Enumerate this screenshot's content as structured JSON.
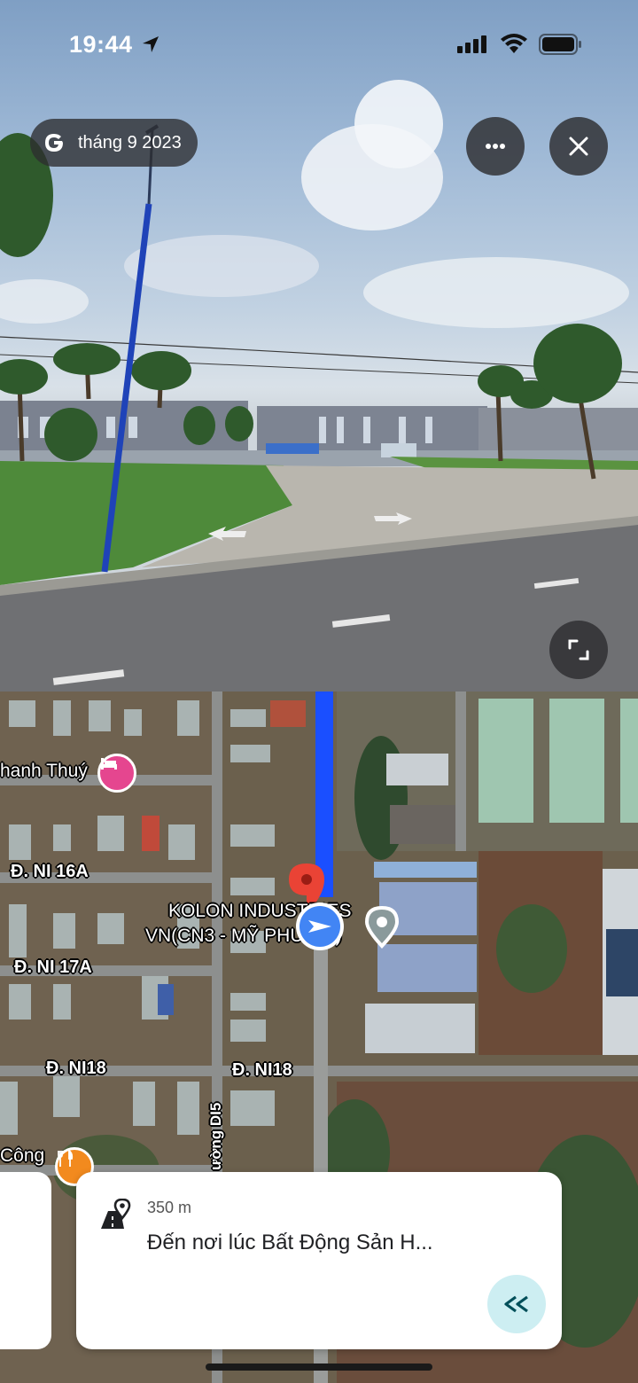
{
  "status_bar": {
    "time": "19:44"
  },
  "street_view": {
    "date_label": "tháng 9 2023"
  },
  "map": {
    "labels": {
      "hotel": "hanh Thuý",
      "road_ni16a": "Đ. NI 16A",
      "road_ni17a": "Đ. NI 17A",
      "road_ni18_left": "Đ. NI18",
      "road_ni18_right": "Đ. NI18",
      "road_di5": "ường DI5",
      "poi_cong": "Công",
      "place_line1": "KOLON INDUSTRIES",
      "place_line2": "VN(CN3 - MỸ PHƯỚC)"
    },
    "route_color": "#1a4fff"
  },
  "navigation_card": {
    "distance": "350 m",
    "instruction": "Đến nơi lúc Bất Động Sản H..."
  }
}
